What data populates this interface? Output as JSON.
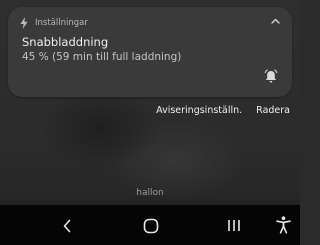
{
  "notification": {
    "app_name": "Inställningar",
    "title": "Snabbladdning",
    "text": "45 % (59 min till full laddning)",
    "progress_percent": 45,
    "icons": {
      "app": "lightning-bolt-icon",
      "expand": "chevron-up-icon",
      "alert": "bell-alert-icon"
    }
  },
  "actions": {
    "settings_label": "Aviseringsinställn.",
    "clear_label": "Radera"
  },
  "status": {
    "carrier": "hallon"
  },
  "navigation": {
    "icons": [
      "back-icon",
      "home-icon",
      "recents-icon",
      "accessibility-icon"
    ]
  },
  "colors": {
    "card_background": "#3a3a3a",
    "screen_background": "#2b2b2b",
    "navbar_background": "#050505",
    "primary_text": "#eeeeee",
    "secondary_text": "#c4c4c4"
  }
}
